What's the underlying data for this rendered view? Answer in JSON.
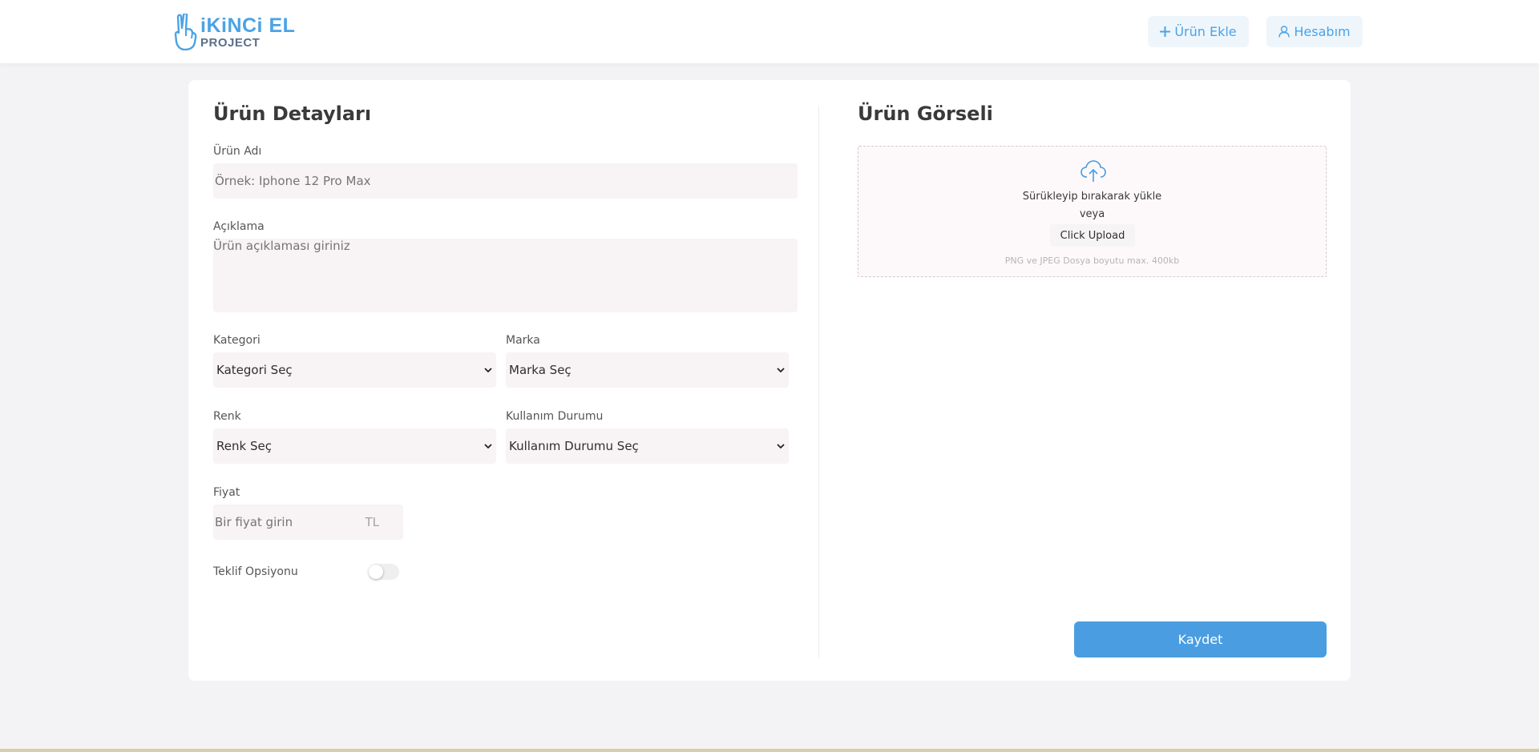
{
  "header": {
    "logo_main": "iKiNCi EL",
    "logo_sub": "PROJECT",
    "add_product_label": "Ürün Ekle",
    "account_label": "Hesabım"
  },
  "details": {
    "title": "Ürün Detayları",
    "name_label": "Ürün Adı",
    "name_placeholder": "Örnek: Iphone 12 Pro Max",
    "desc_label": "Açıklama",
    "desc_placeholder": "Ürün açıklaması giriniz",
    "category_label": "Kategori",
    "category_value": "Kategori Seç",
    "brand_label": "Marka",
    "brand_value": "Marka Seç",
    "color_label": "Renk",
    "color_value": "Renk Seç",
    "condition_label": "Kullanım Durumu",
    "condition_value": "Kullanım Durumu Seç",
    "price_label": "Fiyat",
    "price_placeholder": "Bir fiyat girin",
    "price_currency": "TL",
    "offer_label": "Teklif Opsiyonu",
    "offer_enabled": false
  },
  "image": {
    "title": "Ürün Görseli",
    "drag_text": "Sürükleyip bırakarak yükle",
    "or_text": "veya",
    "upload_button": "Click Upload",
    "hint": "PNG ve JPEG Dosya boyutu max. 400kb"
  },
  "save_label": "Kaydet",
  "colors": {
    "accent": "#4a9de0",
    "field_bg": "#f8f3f5",
    "page_bg": "#f3f2f4"
  }
}
